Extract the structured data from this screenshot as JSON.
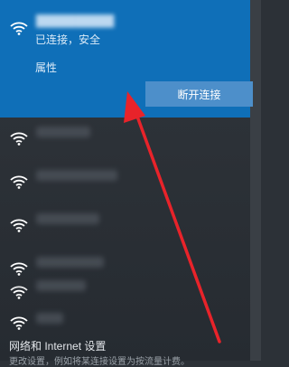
{
  "colors": {
    "accent": "#0f6fb8",
    "button": "#4d8fca",
    "panel": "#2c3137",
    "annotation": "#e8232a"
  },
  "active_network": {
    "icon": "wifi-icon",
    "status": "已连接，安全",
    "properties_label": "属性",
    "disconnect_label": "断开连接"
  },
  "other_networks": [
    {
      "icon": "wifi-icon"
    },
    {
      "icon": "wifi-icon"
    },
    {
      "icon": "wifi-icon"
    },
    {
      "icon": "wifi-icon"
    },
    {
      "icon": "wifi-icon"
    },
    {
      "icon": "wifi-icon"
    }
  ],
  "footer": {
    "settings_label": "网络和 Internet 设置",
    "settings_description": "更改设置，例如将某连接设置为按流量计费。"
  }
}
